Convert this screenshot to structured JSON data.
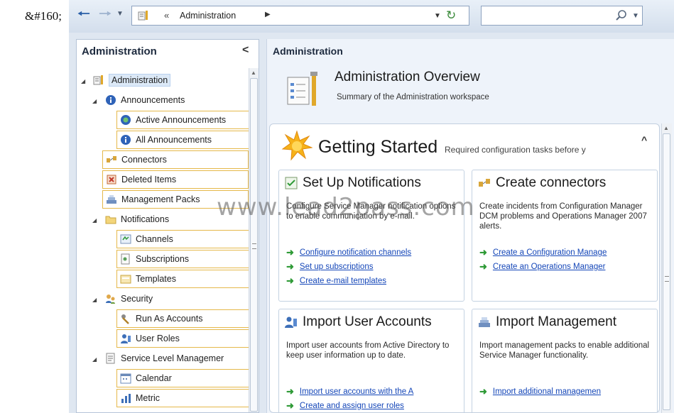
{
  "artifact_text": "&#160;",
  "navbar": {
    "address_separator": "«",
    "breadcrumb": "Administration",
    "search_value": "",
    "search_placeholder": ""
  },
  "left_pane": {
    "title": "Administration",
    "collapse_glyph": "<",
    "tree": [
      {
        "label": "Administration",
        "level": 0,
        "expanded": true,
        "selected": true,
        "icon": "administration-icon"
      },
      {
        "label": "Announcements",
        "level": 1,
        "expanded": true,
        "icon": "info-icon"
      },
      {
        "label": "Active Announcements",
        "level": 2,
        "boxed": true,
        "icon": "active-announcement-icon"
      },
      {
        "label": "All Announcements",
        "level": 2,
        "boxed": true,
        "icon": "info-icon"
      },
      {
        "label": "Connectors",
        "level": 1,
        "boxed": true,
        "icon": "connector-icon"
      },
      {
        "label": "Deleted Items",
        "level": 1,
        "boxed": true,
        "icon": "deleted-items-icon"
      },
      {
        "label": "Management Packs",
        "level": 1,
        "boxed": true,
        "icon": "management-pack-icon"
      },
      {
        "label": "Notifications",
        "level": 1,
        "expanded": true,
        "icon": "folder-icon"
      },
      {
        "label": "Channels",
        "level": 2,
        "boxed": true,
        "icon": "channel-icon"
      },
      {
        "label": "Subscriptions",
        "level": 2,
        "boxed": true,
        "icon": "subscription-icon"
      },
      {
        "label": "Templates",
        "level": 2,
        "boxed": true,
        "icon": "template-icon"
      },
      {
        "label": "Security",
        "level": 1,
        "expanded": true,
        "icon": "security-icon"
      },
      {
        "label": "Run As Accounts",
        "level": 2,
        "boxed": true,
        "icon": "run-as-icon"
      },
      {
        "label": "User Roles",
        "level": 2,
        "boxed": true,
        "icon": "user-roles-icon"
      },
      {
        "label": "Service Level Managemer",
        "level": 1,
        "expanded": true,
        "icon": "service-level-icon"
      },
      {
        "label": "Calendar",
        "level": 2,
        "boxed": true,
        "icon": "calendar-icon"
      },
      {
        "label": "Metric",
        "level": 2,
        "boxed": true,
        "icon": "metric-icon"
      }
    ]
  },
  "main": {
    "title": "Administration",
    "overview_title": "Administration Overview",
    "overview_subtitle": "Summary of the Administration workspace",
    "getting_started_title": "Getting Started",
    "getting_started_subtitle": "Required configuration tasks before y",
    "cards": [
      {
        "title": "Set Up Notifications",
        "icon": "notification-setup-icon",
        "description": "Configure Service Manager notification options to enable communication by e-mail.",
        "links": [
          "Configure notification channels",
          "Set up subscriptions",
          "Create e-mail templates"
        ]
      },
      {
        "title": "Create connectors",
        "icon": "connector-icon",
        "description": "Create incidents from Configuration Manager DCM problems and Operations Manager 2007 alerts.",
        "links": [
          "Create a Configuration Manage",
          "Create an Operations Manager"
        ]
      },
      {
        "title": "Import User Accounts",
        "icon": "user-accounts-icon",
        "description": "Import user accounts from Active Directory to keep user information up to date.",
        "links": [
          "Import user accounts with the A",
          "Create and assign user roles"
        ]
      },
      {
        "title": "Import Management",
        "icon": "management-pack-icon",
        "description": "Import management packs to enable additional Service Manager functionality.",
        "links": [
          "Import additional managemen"
        ]
      }
    ],
    "watermark": "www.lead2pass.com"
  },
  "colors": {
    "accent_link": "#1446b8",
    "link_arrow": "#2e9a36",
    "tree_box_border": "#e5b84a",
    "nav_back": "#2a5fa8"
  }
}
